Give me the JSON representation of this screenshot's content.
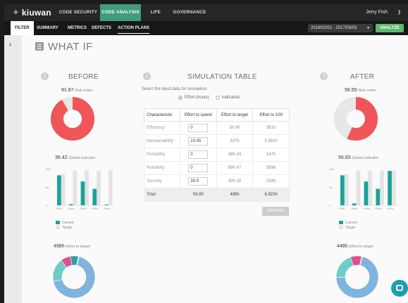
{
  "app": {
    "logo": "kiuwan",
    "user": "Jerry Fish"
  },
  "nav": [
    {
      "label": "CODE SECURITY",
      "active": false
    },
    {
      "label": "CODE ANALYSIS",
      "active": true
    },
    {
      "label": "LIFE CYCLE",
      "active": false
    },
    {
      "label": "GOVERNANCE",
      "active": false
    }
  ],
  "subnav": [
    "FILTER",
    "SUMMARY",
    "METRICS",
    "DEFECTS",
    "ACTION PLANS"
  ],
  "date_range": "2016/02/01 - 2017/03/03",
  "analyze_label": "ANALYZE",
  "page_title": "WHAT IF",
  "before": {
    "step": "1",
    "title": "BEFORE",
    "risk_value": "91.87",
    "risk_label": "Risk index",
    "risk_pct": 0.9187,
    "global_value": "36.42",
    "global_label": "Global indicator",
    "effort_value": "498h",
    "effort_label": "Effort to target"
  },
  "simulation": {
    "step": "2",
    "title": "SIMULATION TABLE",
    "instruction": "Select the input data for simulation:",
    "option_effort": "Effort (hours)",
    "option_indicators": "Indicators",
    "columns": [
      "Characteristic",
      "Effort to spend",
      "Effort to target",
      "Effort to 100"
    ],
    "rows": [
      {
        "name": "Efficiency",
        "spend": "0",
        "target": "3h 00",
        "to100": "361h"
      },
      {
        "name": "Maintainability",
        "spend": "19.95",
        "target": "337h",
        "to100": "5,581h"
      },
      {
        "name": "Portability",
        "spend": "0",
        "target": "38h 24",
        "to100": "147h"
      },
      {
        "name": "Reliability",
        "spend": "0",
        "target": "89h 47",
        "to100": "599h"
      },
      {
        "name": "Security",
        "spend": "39.9",
        "target": "30h 18",
        "to100": "233h"
      }
    ],
    "total": {
      "name": "Total",
      "spend": "59.85",
      "target": "498h",
      "to100": "6,923h"
    },
    "simulate_label": "Simulate"
  },
  "after": {
    "step": "3",
    "title": "AFTER",
    "risk_value": "56.55",
    "risk_label": "Risk index",
    "risk_pct": 0.5655,
    "global_value": "56.83",
    "global_label": "Global indicator",
    "effort_value": "448h",
    "effort_label": "Effort to target"
  },
  "chart_data": [
    {
      "type": "bar",
      "chart": "before-global",
      "categories": [
        "Effic...",
        "Main...",
        "Porta...",
        "Relia...",
        "Secu..."
      ],
      "ylim": [
        0,
        100
      ],
      "yticks": [
        "100",
        "50",
        "0"
      ],
      "series": [
        {
          "name": "Current",
          "values": [
            82,
            3,
            65,
            45,
            2
          ]
        },
        {
          "name": "Target",
          "values": [
            85,
            95,
            95,
            95,
            95
          ]
        }
      ]
    },
    {
      "type": "bar",
      "chart": "after-global",
      "categories": [
        "Effic...",
        "Main...",
        "Porta...",
        "Relia...",
        "Secu..."
      ],
      "ylim": [
        0,
        100
      ],
      "yticks": [
        "100",
        "50",
        "0"
      ],
      "series": [
        {
          "name": "Current",
          "values": [
            82,
            5,
            65,
            45,
            94
          ]
        },
        {
          "name": "Target",
          "values": [
            85,
            95,
            95,
            95,
            95
          ]
        }
      ]
    },
    {
      "type": "pie",
      "chart": "before-effort",
      "values": [
        337,
        89.8,
        38.4,
        30.3,
        3
      ]
    },
    {
      "type": "pie",
      "chart": "after-effort",
      "values": [
        317,
        89.8,
        38.4,
        0,
        3
      ]
    }
  ],
  "legend": {
    "current": "Current",
    "target": "Target"
  },
  "colors": {
    "risk_red": "#f05559",
    "ring_grey": "#e7e7e7",
    "current_teal": "#1aa39a",
    "target_grey": "#e3e3e3",
    "donut": [
      "#7fb4dc",
      "#de4f96",
      "#2fa09b",
      "#6ecdc6",
      "#9dd5cf"
    ],
    "accent_green": "#5fb870"
  }
}
